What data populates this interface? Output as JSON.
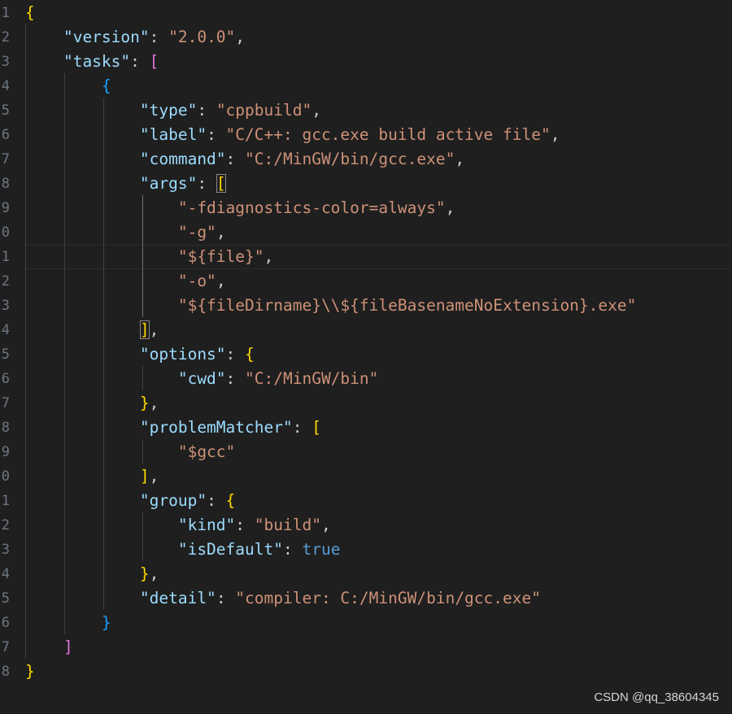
{
  "editor": {
    "gutter_numbers": [
      "1",
      "2",
      "3",
      "4",
      "5",
      "6",
      "7",
      "8",
      "9",
      "0",
      "1",
      "2",
      "3",
      "4",
      "5",
      "6",
      "7",
      "8",
      "9",
      "0",
      "1",
      "2",
      "3",
      "4",
      "5",
      "6",
      "7",
      "8"
    ],
    "lines": [
      [
        [
          "br1",
          "{"
        ]
      ],
      [
        [
          "k",
          "    \"version\""
        ],
        [
          "p",
          ": "
        ],
        [
          "s",
          "\"2.0.0\""
        ],
        [
          "p",
          ","
        ]
      ],
      [
        [
          "k",
          "    \"tasks\""
        ],
        [
          "p",
          ": "
        ],
        [
          "br2",
          "["
        ]
      ],
      [
        [
          "br3",
          "        {"
        ]
      ],
      [
        [
          "k",
          "            \"type\""
        ],
        [
          "p",
          ": "
        ],
        [
          "s",
          "\"cppbuild\""
        ],
        [
          "p",
          ","
        ]
      ],
      [
        [
          "k",
          "            \"label\""
        ],
        [
          "p",
          ": "
        ],
        [
          "s",
          "\"C/C++: gcc.exe build active file\""
        ],
        [
          "p",
          ","
        ]
      ],
      [
        [
          "k",
          "            \"command\""
        ],
        [
          "p",
          ": "
        ],
        [
          "s",
          "\"C:/MinGW/bin/gcc.exe\""
        ],
        [
          "p",
          ","
        ]
      ],
      [
        [
          "k",
          "            \"args\""
        ],
        [
          "p",
          ": "
        ],
        [
          "br1 match",
          "["
        ]
      ],
      [
        [
          "s",
          "                \"-fdiagnostics-color=always\""
        ],
        [
          "p",
          ","
        ]
      ],
      [
        [
          "s",
          "                \"-g\""
        ],
        [
          "p",
          ","
        ]
      ],
      [
        [
          "s",
          "                \"${file}\""
        ],
        [
          "p",
          ","
        ]
      ],
      [
        [
          "s",
          "                \"-o\""
        ],
        [
          "p",
          ","
        ]
      ],
      [
        [
          "s",
          "                \"${fileDirname}\\\\${fileBasenameNoExtension}.exe\""
        ]
      ],
      [
        [
          "p",
          "            "
        ],
        [
          "br1 match",
          "]"
        ],
        [
          "p",
          ","
        ]
      ],
      [
        [
          "k",
          "            \"options\""
        ],
        [
          "p",
          ": "
        ],
        [
          "br1",
          "{"
        ]
      ],
      [
        [
          "k",
          "                \"cwd\""
        ],
        [
          "p",
          ": "
        ],
        [
          "s",
          "\"C:/MinGW/bin\""
        ]
      ],
      [
        [
          "p",
          "            "
        ],
        [
          "br1",
          "}"
        ],
        [
          "p",
          ","
        ]
      ],
      [
        [
          "k",
          "            \"problemMatcher\""
        ],
        [
          "p",
          ": "
        ],
        [
          "br1",
          "["
        ]
      ],
      [
        [
          "s",
          "                \"$gcc\""
        ]
      ],
      [
        [
          "p",
          "            "
        ],
        [
          "br1",
          "]"
        ],
        [
          "p",
          ","
        ]
      ],
      [
        [
          "k",
          "            \"group\""
        ],
        [
          "p",
          ": "
        ],
        [
          "br1",
          "{"
        ]
      ],
      [
        [
          "k",
          "                \"kind\""
        ],
        [
          "p",
          ": "
        ],
        [
          "s",
          "\"build\""
        ],
        [
          "p",
          ","
        ]
      ],
      [
        [
          "k",
          "                \"isDefault\""
        ],
        [
          "p",
          ": "
        ],
        [
          "b",
          "true"
        ]
      ],
      [
        [
          "p",
          "            "
        ],
        [
          "br1",
          "}"
        ],
        [
          "p",
          ","
        ]
      ],
      [
        [
          "k",
          "            \"detail\""
        ],
        [
          "p",
          ": "
        ],
        [
          "s",
          "\"compiler: C:/MinGW/bin/gcc.exe\""
        ]
      ],
      [
        [
          "br3",
          "        }"
        ]
      ],
      [
        [
          "br2",
          "    ]"
        ]
      ],
      [
        [
          "br1",
          "}"
        ]
      ]
    ]
  },
  "watermark": "CSDN @qq_38604345"
}
